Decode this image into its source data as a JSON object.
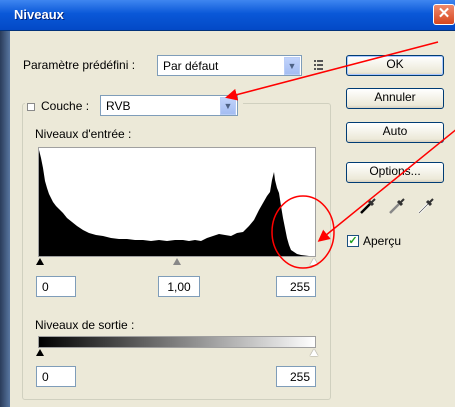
{
  "window": {
    "title": "Niveaux",
    "close_glyph": "✕"
  },
  "preset": {
    "label": "Paramètre prédéfini :",
    "value": "Par défaut",
    "menu_icon": "list-menu-icon"
  },
  "channel": {
    "label": "Couche :",
    "value": "RVB"
  },
  "input_levels": {
    "label": "Niveaux d'entrée :",
    "black": "0",
    "gamma": "1,00",
    "white": "255"
  },
  "output_levels": {
    "label": "Niveaux de sortie :",
    "black": "0",
    "white": "255"
  },
  "buttons": {
    "ok": "OK",
    "cancel": "Annuler",
    "auto": "Auto",
    "options": "Options..."
  },
  "eyedroppers": [
    "black-eyedropper-icon",
    "gray-eyedropper-icon",
    "white-eyedropper-icon"
  ],
  "preview": {
    "label": "Aperçu",
    "checked": true
  },
  "annotation": {
    "color": "#ff0000"
  }
}
